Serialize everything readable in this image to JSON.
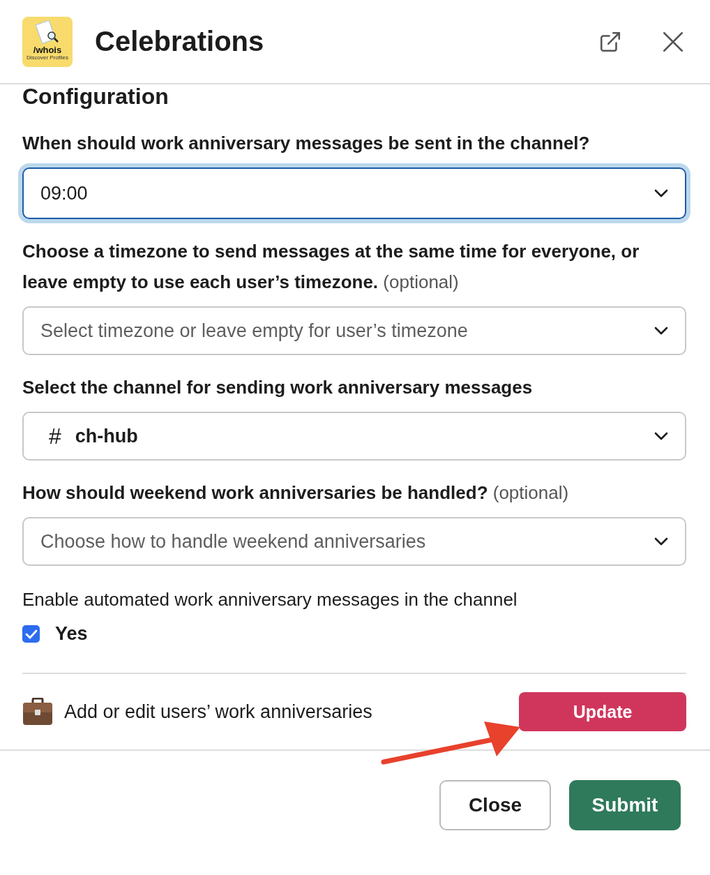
{
  "header": {
    "logo": {
      "title": "/whois",
      "subtitle": "Discover Profiles"
    },
    "title": "Celebrations"
  },
  "section_title": "Configuration",
  "fields": [
    {
      "kind": "select",
      "label": "When should work anniversary messages be sent in the channel?",
      "value": "09:00",
      "focused": true
    },
    {
      "kind": "select",
      "label": "Choose a timezone to send messages at the same time for everyone, or leave empty to use each user’s timezone.",
      "optional": "(optional)",
      "placeholder": "Select timezone or leave empty for user’s timezone",
      "focused": false
    },
    {
      "kind": "select",
      "label": "Select the channel for sending work anniversary messages",
      "prefix": "#",
      "value": "ch-hub",
      "focused": false
    },
    {
      "kind": "select",
      "label": "How should weekend work anniversaries be handled?",
      "optional": "(optional)",
      "placeholder": "Choose how to handle weekend anniversaries",
      "focused": false
    },
    {
      "kind": "checkbox",
      "label": "Enable automated work anniversary messages in the channel",
      "option": {
        "label": "Yes",
        "checked": true
      }
    }
  ],
  "action_row": {
    "text": "Add or edit users’ work anniversaries",
    "button": "Update"
  },
  "footer_buttons": [
    {
      "label": "Close",
      "kind": "secondary"
    },
    {
      "label": "Submit",
      "kind": "primary"
    }
  ]
}
